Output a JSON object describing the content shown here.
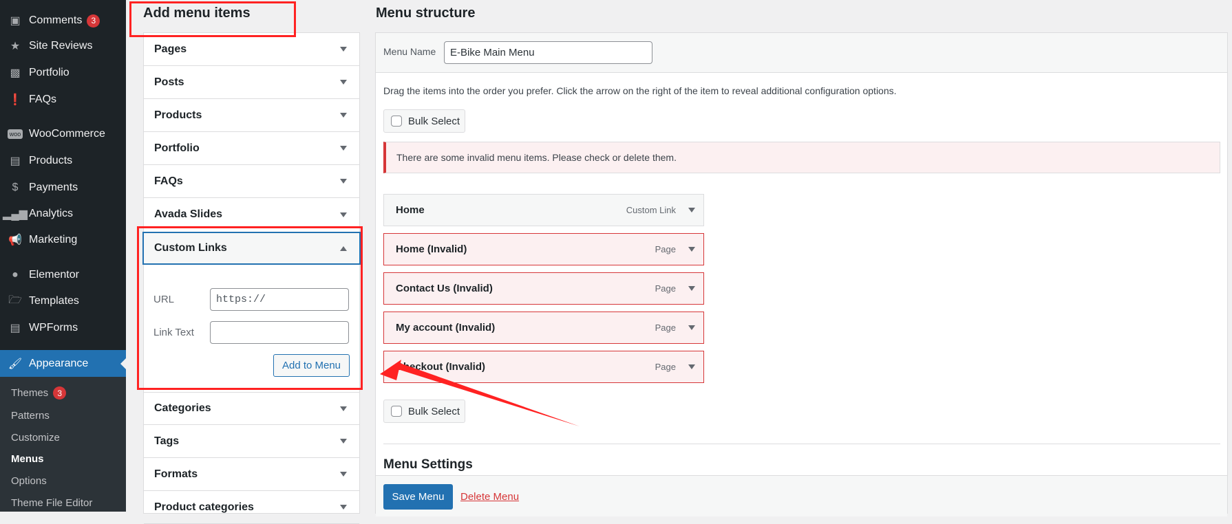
{
  "sidebar": {
    "items": [
      {
        "label": "Comments",
        "icon": "comment-icon",
        "badge": "3"
      },
      {
        "label": "Site Reviews",
        "icon": "star-icon"
      },
      {
        "label": "Portfolio",
        "icon": "portfolio-icon"
      },
      {
        "label": "FAQs",
        "icon": "info-icon"
      },
      {
        "label": "WooCommerce",
        "icon": "woo-icon"
      },
      {
        "label": "Products",
        "icon": "archive-icon"
      },
      {
        "label": "Payments",
        "icon": "dollar-icon"
      },
      {
        "label": "Analytics",
        "icon": "chart-icon"
      },
      {
        "label": "Marketing",
        "icon": "megaphone-icon"
      },
      {
        "label": "Elementor",
        "icon": "elementor-icon"
      },
      {
        "label": "Templates",
        "icon": "folder-icon"
      },
      {
        "label": "WPForms",
        "icon": "form-icon"
      }
    ],
    "active": {
      "label": "Appearance",
      "icon": "brush-icon"
    },
    "submenu": [
      {
        "label": "Themes",
        "badge": "3"
      },
      {
        "label": "Patterns"
      },
      {
        "label": "Customize"
      },
      {
        "label": "Menus"
      },
      {
        "label": "Options"
      },
      {
        "label": "Theme File Editor"
      }
    ]
  },
  "add_items": {
    "title": "Add menu items",
    "sections_top": [
      "Pages",
      "Posts",
      "Products",
      "Portfolio",
      "FAQs",
      "Avada Slides"
    ],
    "custom": {
      "title": "Custom Links",
      "url_label": "URL",
      "url_value": "https://",
      "link_text_label": "Link Text",
      "link_text_value": "",
      "button": "Add to Menu"
    },
    "sections_bottom": [
      "Categories",
      "Tags",
      "Formats",
      "Product categories"
    ]
  },
  "structure": {
    "title": "Menu structure",
    "menu_name_label": "Menu Name",
    "menu_name_value": "E-Bike Main Menu",
    "instructions": "Drag the items into the order you prefer. Click the arrow on the right of the item to reveal additional configuration options.",
    "bulk_select": "Bulk Select",
    "notice": "There are some invalid menu items. Please check or delete them.",
    "items": [
      {
        "label": "Home",
        "type": "Custom Link"
      },
      {
        "label": "Home (Invalid)",
        "type": "Page"
      },
      {
        "label": "Contact Us (Invalid)",
        "type": "Page"
      },
      {
        "label": "My account (Invalid)",
        "type": "Page"
      },
      {
        "label": "Checkout (Invalid)",
        "type": "Page"
      }
    ],
    "settings_title": "Menu Settings",
    "save": "Save Menu",
    "delete": "Delete Menu"
  },
  "colors": {
    "accent": "#2271b1",
    "error": "#d63638",
    "annotation": "#ff2222"
  }
}
